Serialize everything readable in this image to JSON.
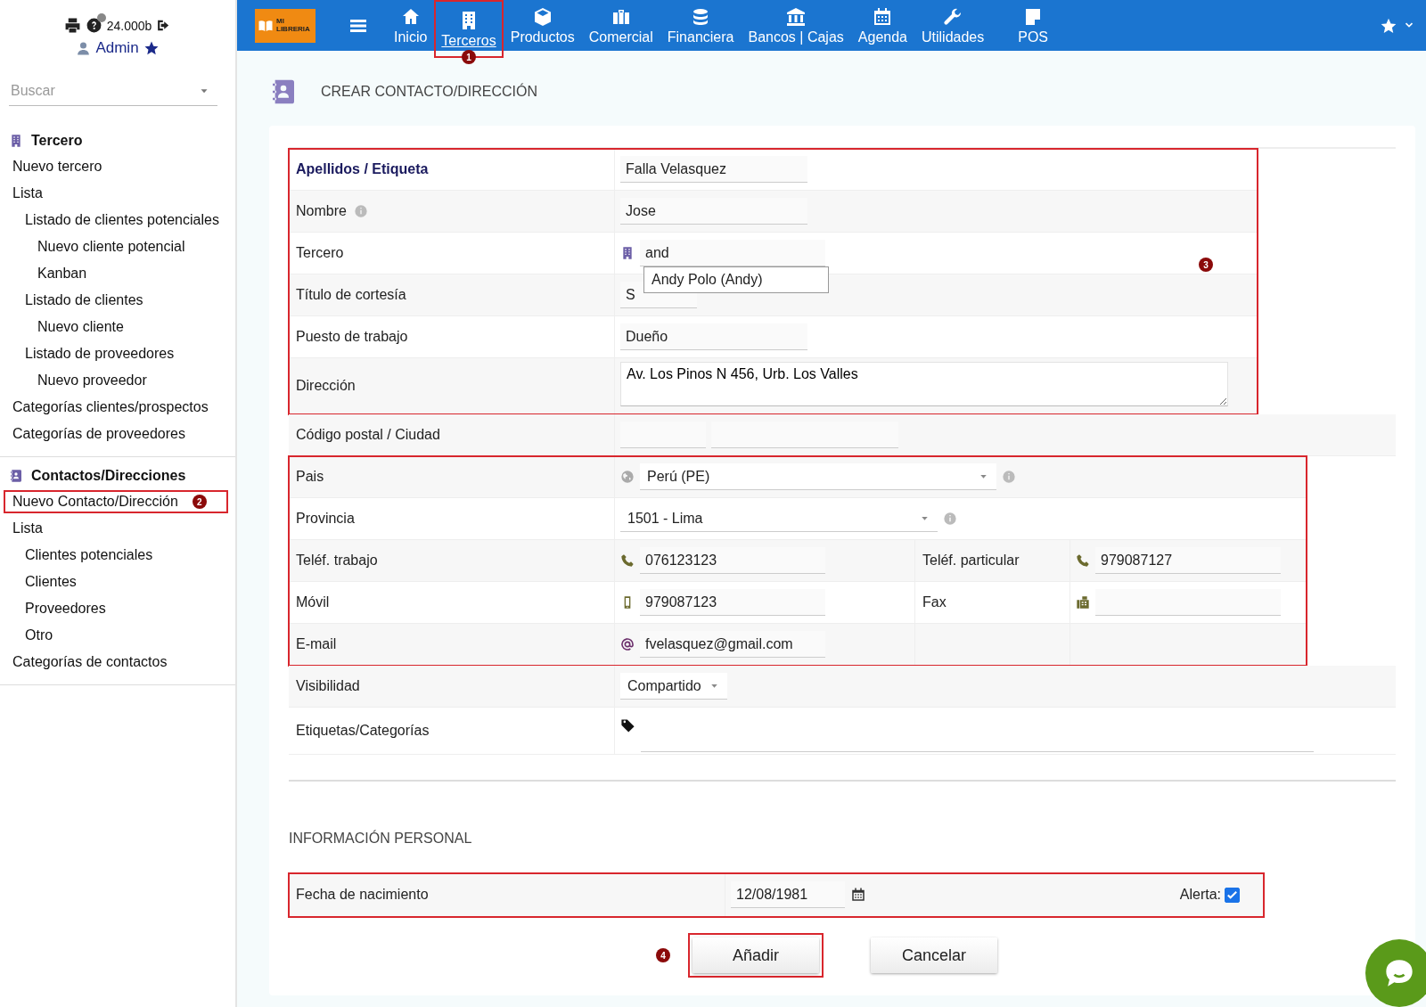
{
  "user_bar": {
    "size": "24.000b",
    "user": "Admin"
  },
  "search": {
    "placeholder": "Buscar"
  },
  "sidebar": {
    "sections": [
      {
        "title": "Tercero",
        "items": [
          {
            "label": "Nuevo tercero",
            "highlighted": false
          },
          {
            "label": "Lista",
            "highlighted": false,
            "children": [
              {
                "label": "Listado de clientes potenciales",
                "highlighted": false,
                "children": [
                  {
                    "label": "Nuevo cliente potencial",
                    "highlighted": false
                  },
                  {
                    "label": "Kanban",
                    "highlighted": false
                  }
                ]
              },
              {
                "label": "Listado de clientes",
                "highlighted": false,
                "children": [
                  {
                    "label": "Nuevo cliente",
                    "highlighted": false
                  }
                ]
              },
              {
                "label": "Listado de proveedores",
                "highlighted": false,
                "children": [
                  {
                    "label": "Nuevo proveedor",
                    "highlighted": false
                  }
                ]
              }
            ]
          },
          {
            "label": "Categorías clientes/prospectos",
            "highlighted": false
          },
          {
            "label": "Categorías de proveedores",
            "highlighted": false
          }
        ]
      },
      {
        "title": "Contactos/Direcciones",
        "items": [
          {
            "label": "Nuevo Contacto/Dirección",
            "highlighted": true,
            "marker": "2"
          },
          {
            "label": "Lista",
            "highlighted": false,
            "children": [
              {
                "label": "Clientes potenciales",
                "highlighted": false
              },
              {
                "label": "Clientes",
                "highlighted": false
              },
              {
                "label": "Proveedores",
                "highlighted": false
              },
              {
                "label": "Otro",
                "highlighted": false
              }
            ]
          },
          {
            "label": "Categorías de contactos",
            "highlighted": false
          }
        ]
      }
    ]
  },
  "topnav": {
    "logo_text": "MI LIBRERIA",
    "items": [
      {
        "label": "Inicio",
        "selected": false,
        "highlighted": false
      },
      {
        "label": "Terceros",
        "selected": true,
        "highlighted": true,
        "marker": "1"
      },
      {
        "label": "Productos",
        "selected": false,
        "highlighted": false
      },
      {
        "label": "Comercial",
        "selected": false,
        "highlighted": false
      },
      {
        "label": "Financiera",
        "selected": false,
        "highlighted": false
      },
      {
        "label": "Bancos | Cajas",
        "selected": false,
        "highlighted": false
      },
      {
        "label": "Agenda",
        "selected": false,
        "highlighted": false
      },
      {
        "label": "Utilidades",
        "selected": false,
        "highlighted": false
      },
      {
        "label": "POS",
        "selected": false,
        "highlighted": false
      }
    ]
  },
  "page": {
    "title": "CREAR CONTACTO/DIRECCIÓN"
  },
  "form": {
    "groups": [
      {
        "highlighted": true,
        "marker": "3",
        "rows": [
          {
            "kind": "text",
            "label": "Apellidos / Etiqueta",
            "required": true,
            "info": false,
            "value": "Falla Velasquez"
          },
          {
            "kind": "text",
            "label": "Nombre",
            "required": false,
            "info": true,
            "value": "Jose"
          },
          {
            "kind": "company",
            "label": "Tercero",
            "required": false,
            "info": false,
            "value": "and",
            "suggestion": "Andy Polo (Andy)"
          },
          {
            "kind": "short",
            "label": "Título de cortesía",
            "required": false,
            "info": false,
            "value": "S"
          },
          {
            "kind": "text",
            "label": "Puesto de trabajo",
            "required": false,
            "info": false,
            "value": "Dueño"
          },
          {
            "kind": "textarea",
            "label": "Dirección",
            "required": false,
            "info": false,
            "value": "Av. Los Pinos N 456, Urb. Los Valles"
          }
        ]
      },
      {
        "highlighted": false,
        "rows": [
          {
            "kind": "zip",
            "label": "Código postal / Ciudad",
            "required": false,
            "info": false
          }
        ]
      },
      {
        "highlighted": true,
        "rows": [
          {
            "kind": "country",
            "label": "Pais",
            "required": false,
            "info": true,
            "value": "Perú (PE)"
          },
          {
            "kind": "select",
            "label": "Provincia",
            "required": false,
            "info": true,
            "value": "1501 - Lima"
          },
          {
            "kind": "pair",
            "fields": [
              {
                "kind": "phone",
                "label": "Teléf. trabajo",
                "value": "076123123"
              },
              {
                "kind": "phone",
                "label": "Teléf. particular",
                "value": "979087127"
              }
            ]
          },
          {
            "kind": "pair",
            "fields": [
              {
                "kind": "mobile",
                "label": "Móvil",
                "value": "979087123"
              },
              {
                "kind": "fax",
                "label": "Fax"
              }
            ]
          },
          {
            "kind": "pair",
            "fields": [
              {
                "kind": "email",
                "label": "E-mail",
                "value": "fvelasquez@gmail.com"
              }
            ]
          }
        ]
      },
      {
        "highlighted": false,
        "rows": [
          {
            "kind": "dropdown",
            "label": "Visibilidad",
            "required": false,
            "info": false,
            "value": "Compartido"
          },
          {
            "kind": "tags",
            "label": "Etiquetas/Categorías",
            "required": false,
            "info": false
          }
        ]
      }
    ]
  },
  "personal": {
    "title": "INFORMACIÓN PERSONAL",
    "highlighted": true,
    "birth_label": "Fecha de nacimiento",
    "birth_value": "12/08/1981",
    "alert_label": "Alerta:",
    "alert_checked": true
  },
  "buttons": [
    {
      "label": "Añadir",
      "highlighted": true,
      "marker": "4"
    },
    {
      "label": "Cancelar",
      "highlighted": false
    }
  ]
}
